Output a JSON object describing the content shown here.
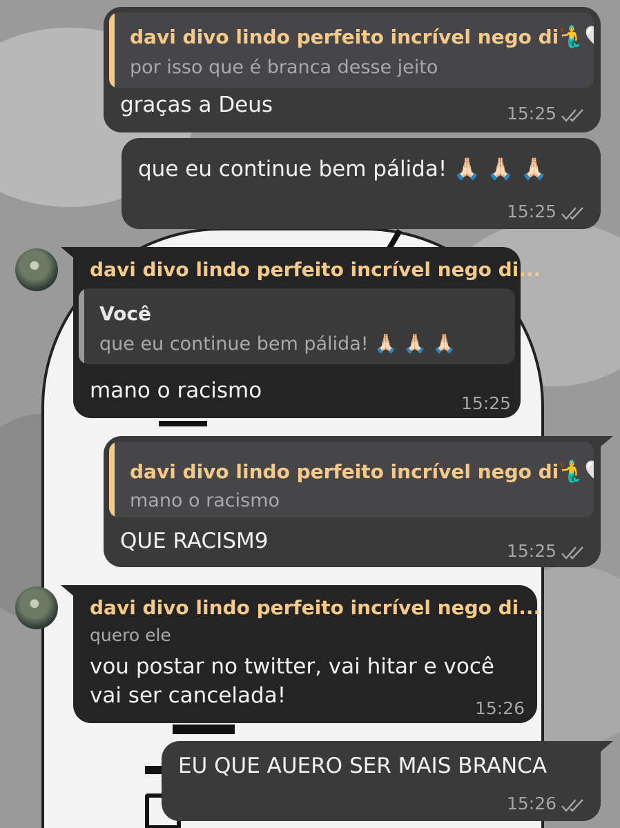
{
  "colors": {
    "accent_name": "#f4c98a",
    "quote_bar_accent": "#f4c98a",
    "quote_bar_self": "#9a9a9c",
    "bubble_outgoing": "#3a3a3b",
    "bubble_incoming": "#242425"
  },
  "messages": [
    {
      "direction": "outgoing",
      "reply_to": {
        "name": "davi divo lindo perfeito incrível nego di",
        "name_emojis": "🧜‍♂️🤍",
        "text": "por isso que é branca desse jeito"
      },
      "text": "graças a Deus",
      "time": "15:25",
      "status_icon": "double-check-icon"
    },
    {
      "direction": "outgoing",
      "text": "que eu continue bem pálida! 🙏🏻 🙏🏻 🙏🏻",
      "time": "15:25",
      "status_icon": "double-check-icon"
    },
    {
      "direction": "incoming",
      "sender": "davi divo lindo perfeito incrível nego di...",
      "reply_to": {
        "name": "Você",
        "text": "que eu continue bem pálida! 🙏🏻 🙏🏻 🙏🏻"
      },
      "text": "mano o racismo",
      "time": "15:25"
    },
    {
      "direction": "outgoing",
      "reply_to": {
        "name": "davi divo lindo perfeito incrível nego di",
        "name_emojis": "🧜‍♂️🤍",
        "text": "mano o racismo"
      },
      "text": "QUE RACISM9",
      "time": "15:25",
      "status_icon": "double-check-icon"
    },
    {
      "direction": "incoming",
      "sender": "davi divo lindo perfeito incrível nego di...",
      "subtitle": "quero ele",
      "text_lines": [
        "vou postar no twitter, vai hitar  e você",
        "vai ser cancelada!"
      ],
      "time": "15:26"
    },
    {
      "direction": "outgoing",
      "text": "EU QUE AUERO SER MAIS BRANCA",
      "time": "15:26",
      "status_icon": "double-check-icon"
    }
  ]
}
